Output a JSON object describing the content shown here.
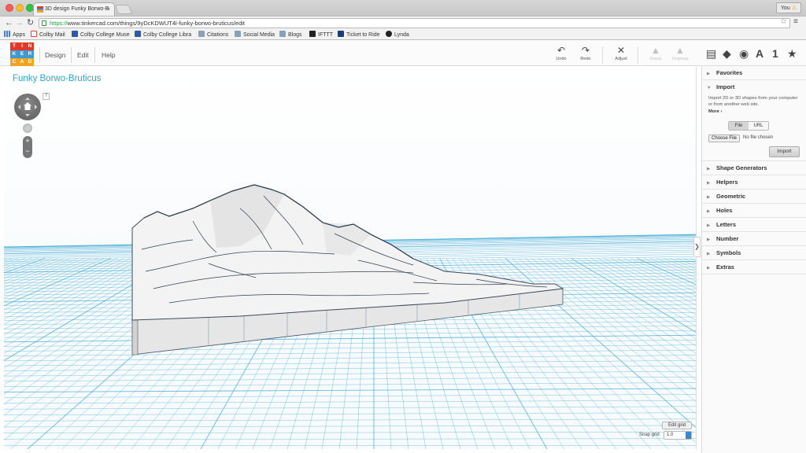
{
  "browser": {
    "tab_title": "3D design Funky Borwo-B",
    "url_protocol": "https://",
    "url_rest": "www.tinkercad.com/things/9yDcKDWUT4l-funky-borwo-bruticus/edit",
    "user_label": "You",
    "bookmarks": [
      {
        "label": "Apps",
        "icon": "apps-icon"
      },
      {
        "label": "Colby Mail",
        "icon": "gmail-icon"
      },
      {
        "label": "Colby College Muse",
        "icon": "museum-icon"
      },
      {
        "label": "Colby College Libra",
        "icon": "library-icon"
      },
      {
        "label": "Citations",
        "icon": "folder-icon"
      },
      {
        "label": "Social Media",
        "icon": "folder-icon"
      },
      {
        "label": "Blogs",
        "icon": "folder-icon"
      },
      {
        "label": "IFTTT",
        "icon": "ifttt-icon"
      },
      {
        "label": "Ticket to Ride",
        "icon": "ticket-icon"
      },
      {
        "label": "Lynda",
        "icon": "lynda-icon"
      }
    ]
  },
  "app": {
    "logo_letters": [
      "T",
      "I",
      "N",
      "K",
      "E",
      "R",
      "C",
      "A",
      "D"
    ],
    "logo_colors": [
      "#e1382b",
      "#e1382b",
      "#e1382b",
      "#3d9ad6",
      "#3d9ad6",
      "#3d9ad6",
      "#f2a51c",
      "#f2a51c",
      "#f2a51c"
    ],
    "menu": [
      "Design",
      "Edit",
      "Help"
    ],
    "tools": [
      {
        "label": "Undo",
        "icon": "undo-icon",
        "glyph": "↶",
        "enabled": true
      },
      {
        "label": "Redo",
        "icon": "redo-icon",
        "glyph": "↷",
        "enabled": true
      },
      {
        "label": "Adjust",
        "icon": "adjust-icon",
        "glyph": "✕",
        "enabled": true
      },
      {
        "label": "Group",
        "icon": "group-icon",
        "glyph": "▲",
        "enabled": false
      },
      {
        "label": "Ungroup",
        "icon": "ungroup-icon",
        "glyph": "▲",
        "enabled": false
      }
    ],
    "right_icons": [
      {
        "name": "book-icon",
        "glyph": "▤"
      },
      {
        "name": "cube-icon",
        "glyph": "◆"
      },
      {
        "name": "sphere-icon",
        "glyph": "◉"
      },
      {
        "name": "text-icon",
        "glyph": "A"
      },
      {
        "name": "number-icon",
        "glyph": "1"
      },
      {
        "name": "star-icon",
        "glyph": "★"
      }
    ]
  },
  "design": {
    "title": "Funky Borwo-Bruticus",
    "help": "?",
    "edit_grid": "Edit grid",
    "snap_label": "Snap grid",
    "snap_value": "1.0",
    "grid_color": "#3aa7d2"
  },
  "sidebar": {
    "favorites": "Favorites",
    "import": {
      "title": "Import",
      "description": "Import 2D or 3D shapes from your computer or from another web site.",
      "more": "More ›",
      "tab_file": "File",
      "tab_url": "URL",
      "choose_file": "Choose File",
      "no_file": "No file chosen",
      "button": "Import"
    },
    "sections": [
      "Shape Generators",
      "Helpers",
      "Geometric",
      "Holes",
      "Letters",
      "Number",
      "Symbols",
      "Extras"
    ]
  }
}
